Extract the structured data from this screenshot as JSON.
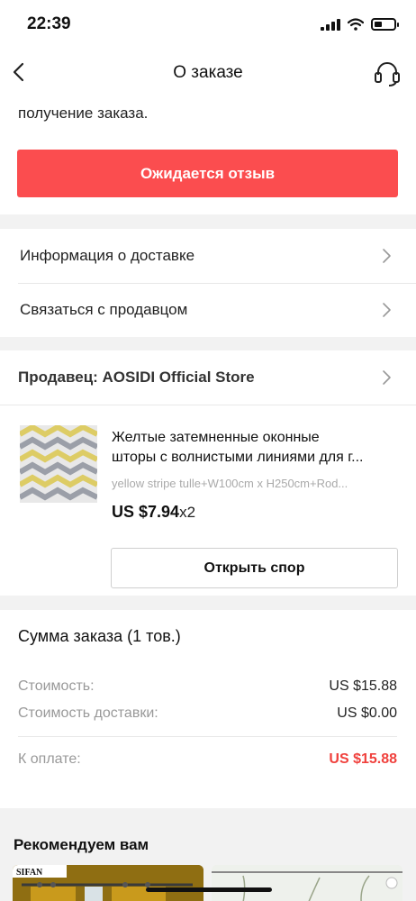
{
  "status_bar": {
    "time": "22:39"
  },
  "nav": {
    "title": "О заказе"
  },
  "top_card": {
    "hint": "получение заказа.",
    "review_button": "Ожидается отзыв"
  },
  "links": [
    {
      "label": "Информация о доставке"
    },
    {
      "label": "Связаться с продавцом"
    }
  ],
  "seller": {
    "label": "Продавец: AOSIDI Official Store"
  },
  "product": {
    "title_line1": "Желтые затемненные оконные",
    "title_line2": "шторы с волнистыми линиями для г...",
    "variant": "yellow stripe tulle+W100cm x H250cm+Rod...",
    "price": "US $7.94",
    "qty": "x2",
    "dispute_button": "Открыть спор"
  },
  "summary": {
    "title": "Сумма заказа (1 тов.)",
    "cost_label": "Стоимость:",
    "cost_value": "US $15.88",
    "shipping_label": "Стоимость доставки:",
    "shipping_value": "US $0.00",
    "total_label": "К оплате:",
    "total_value": "US $15.88"
  },
  "recommendations": {
    "title": "Рекомендуем вам",
    "brand_label": "SIFAN"
  },
  "icons": {
    "back": "chevron-left-icon",
    "support": "headset-icon",
    "chevron": "chevron-right-icon"
  },
  "colors": {
    "accent": "#fb4d4f",
    "total_price": "#f0413d"
  }
}
